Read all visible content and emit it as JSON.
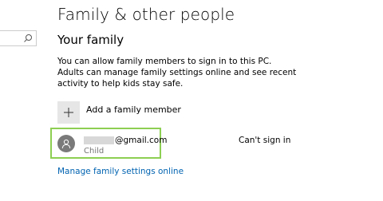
{
  "header": {
    "title": "Family & other people"
  },
  "search": {
    "placeholder": "",
    "icon": "search-icon"
  },
  "family": {
    "heading": "Your family",
    "description": "You can allow family members to sign in to this PC. Adults can manage family settings online and see recent activity to help kids stay safe.",
    "add_member_label": "Add a family member",
    "add_member_icon": "plus-icon",
    "members": [
      {
        "email_visible": "@gmail.com",
        "role": "Child",
        "status": "Can't sign in",
        "avatar_icon": "user-icon"
      }
    ],
    "manage_link": "Manage family settings online"
  },
  "colors": {
    "accent_link": "#0063b1",
    "selection_border": "#8dcf52",
    "avatar_bg": "#7a7a7a",
    "tile_bg": "#e6e6e6",
    "secondary_text": "#767676"
  }
}
